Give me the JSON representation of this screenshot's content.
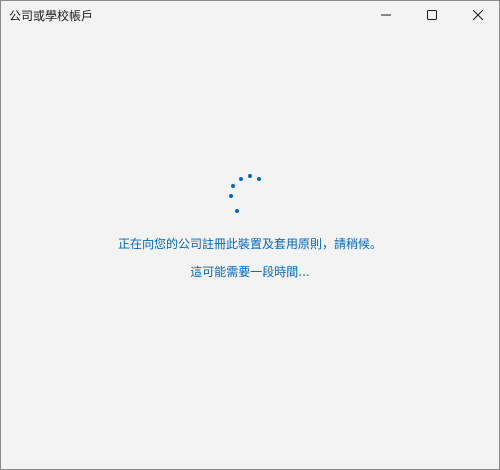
{
  "window": {
    "title": "公司或學校帳戶"
  },
  "titlebar_buttons": {
    "minimize_icon": "minimize-icon",
    "maximize_icon": "maximize-icon",
    "close_icon": "close-icon"
  },
  "content": {
    "message_primary": "正在向您的公司註冊此裝置及套用原則，請稍候。",
    "message_secondary": "這可能需要一段時間..."
  },
  "colors": {
    "accent": "#0067c0",
    "background": "#f3f3f3"
  }
}
